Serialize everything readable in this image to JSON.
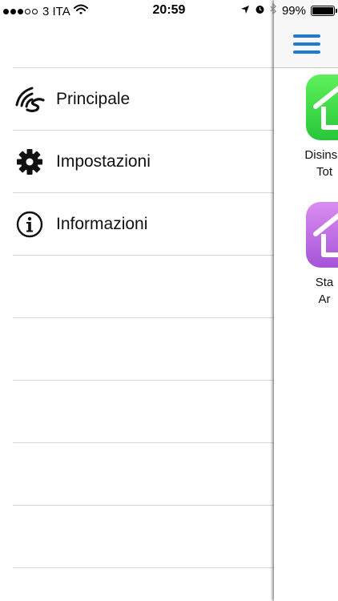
{
  "status_bar": {
    "carrier": "3 ITA",
    "time": "20:59",
    "battery_percent": "99%",
    "signal_bars_filled": 3,
    "signal_bars_total": 5,
    "battery_level": 0.99
  },
  "menu": {
    "items": [
      {
        "label": "Principale",
        "icon": "wireless-signal-icon"
      },
      {
        "label": "Impostazioni",
        "icon": "gear-icon"
      },
      {
        "label": "Informazioni",
        "icon": "info-circle-icon"
      }
    ],
    "empty_rows": 5
  },
  "main": {
    "tiles": [
      {
        "caption_line1": "Disinse",
        "caption_line2": "Tot",
        "color": "#3ed44a",
        "icon": "home-icon"
      },
      {
        "caption_line1": "Sta",
        "caption_line2": "Ar",
        "color": "#c070e6",
        "icon": "home-icon"
      }
    ],
    "accent_color": "#1f7ad6"
  }
}
